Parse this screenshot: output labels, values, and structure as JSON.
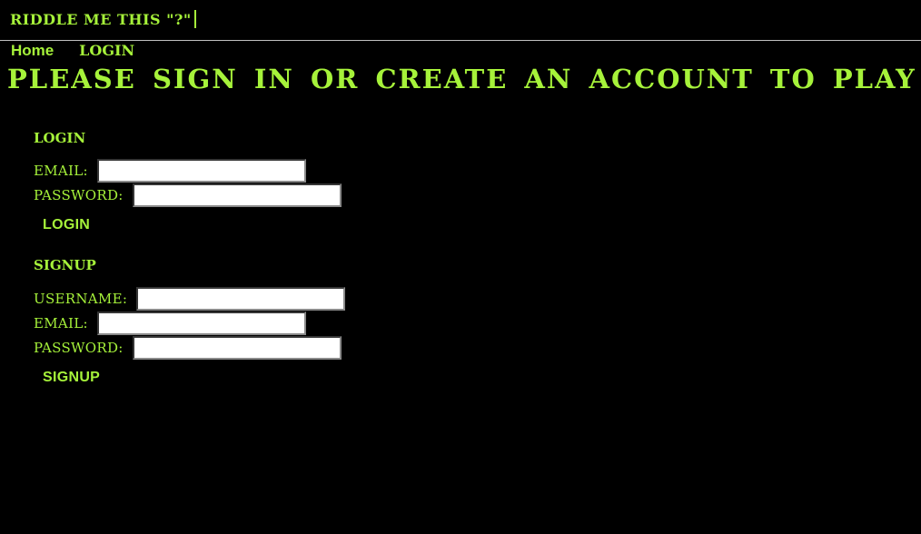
{
  "header": {
    "title": "RIDDLE ME THIS \"?\""
  },
  "nav": {
    "home": "Home",
    "login": "LOGIN"
  },
  "main": {
    "headline": "PLEASE SIGN IN OR CREATE AN ACCOUNT TO PLAY"
  },
  "login": {
    "heading": "LOGIN",
    "email_label": "EMAIL:",
    "email_value": "",
    "password_label": "PASSWORD:",
    "password_value": "",
    "submit_label": "LOGIN"
  },
  "signup": {
    "heading": "SIGNUP",
    "username_label": "USERNAME:",
    "username_value": "",
    "email_label": "EMAIL:",
    "email_value": "",
    "password_label": "PASSWORD:",
    "password_value": "",
    "submit_label": "SIGNUP"
  },
  "colors": {
    "accent": "#a6f23a",
    "background": "#000000"
  }
}
